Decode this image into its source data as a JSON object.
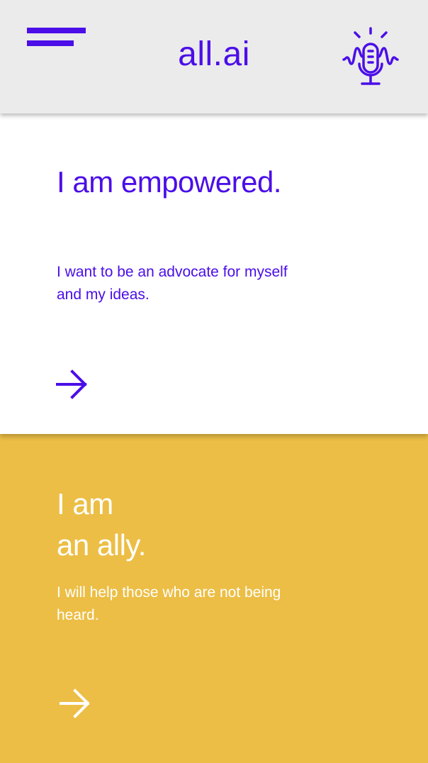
{
  "theme": {
    "accent": "#4b0ee8",
    "header_bg": "#ebebeb",
    "ally_bg": "#ecbe45",
    "card_bg": "#ffffff"
  },
  "header": {
    "title": "all.ai",
    "menu_icon": "hamburger-menu-icon",
    "mic_icon": "microphone-soundwave-icon"
  },
  "cards": [
    {
      "heading": "I am empowered.",
      "body": "I want to be an advocate for myself and my ideas.",
      "arrow_icon": "arrow-right-icon"
    },
    {
      "heading_line1": "I am",
      "heading_line2": "an ally.",
      "body": "I will help those who are not being heard.",
      "arrow_icon": "arrow-right-icon"
    }
  ]
}
